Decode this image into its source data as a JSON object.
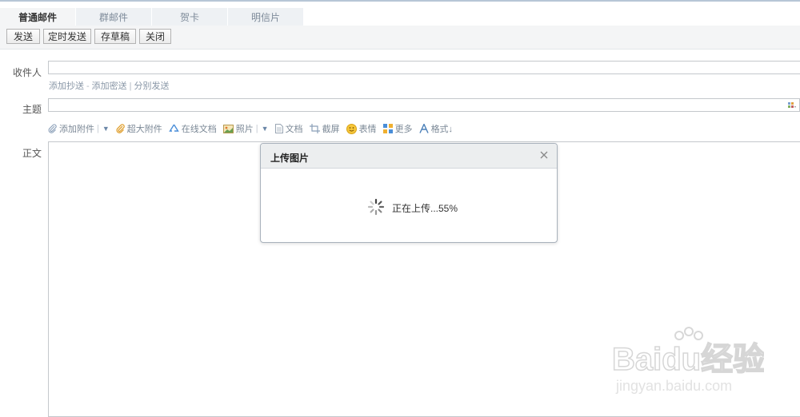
{
  "tabs": [
    {
      "label": "普通邮件",
      "active": true
    },
    {
      "label": "群邮件",
      "active": false
    },
    {
      "label": "贺卡",
      "active": false
    },
    {
      "label": "明信片",
      "active": false
    }
  ],
  "toolbar": {
    "send": "发送",
    "scheduled_send": "定时发送",
    "save_draft": "存草稿",
    "close": "关闭"
  },
  "form": {
    "recipient_label": "收件人",
    "recipient_value": "",
    "add_cc": "添加抄送",
    "dash": "-",
    "add_bcc": "添加密送",
    "pipe": "|",
    "separate_send": "分别发送",
    "subject_label": "主题",
    "subject_value": "",
    "body_label": "正文"
  },
  "attachments": {
    "add_attachment": "添加附件",
    "large_attachment": "超大附件",
    "online_doc": "在线文档",
    "photo": "照片",
    "document": "文档",
    "screenshot": "截屏",
    "emoji": "表情",
    "more": "更多",
    "format": "格式↓"
  },
  "dialog": {
    "title": "上传图片",
    "status": "正在上传...55%",
    "progress_percent": 55
  },
  "watermark": {
    "brand": "Baidu经验",
    "url": "jingyan.baidu.com"
  },
  "icons": {
    "paperclip": "paperclip-icon",
    "large_attachment": "large-paperclip-icon",
    "online_doc": "recycle-doc-icon",
    "photo": "photo-icon",
    "document": "document-icon",
    "screenshot": "screenshot-icon",
    "emoji": "smiley-icon",
    "more": "grid-more-icon",
    "format": "font-format-icon",
    "close": "close-icon",
    "spinner": "loading-spinner-icon"
  },
  "colors": {
    "accent_link": "#8896a6",
    "tab_bg": "#eef1f4",
    "dialog_header": "#eceeef"
  }
}
